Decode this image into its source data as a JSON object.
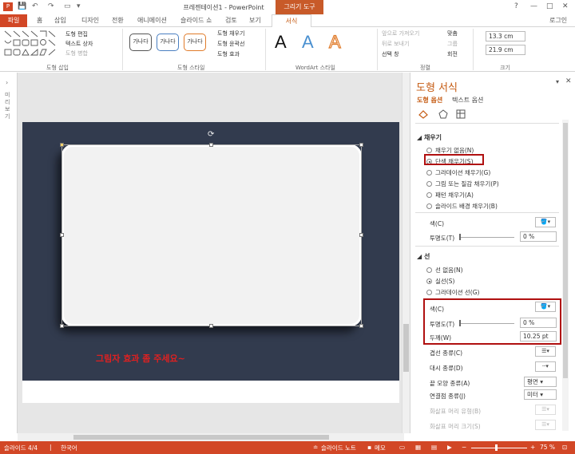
{
  "titlebar": {
    "app_title": "프레젠테이션1 - PowerPoint",
    "context_group": "그리기 도구",
    "help": "?",
    "minimize": "—",
    "restore": "□",
    "close": "✕"
  },
  "tabs": [
    "파일",
    "홈",
    "삽입",
    "디자인",
    "전환",
    "애니메이션",
    "슬라이드 쇼",
    "검토",
    "보기",
    "서식"
  ],
  "signin": "로그인",
  "ribbon": {
    "insert_shapes": {
      "label": "도형 삽입",
      "edit_shape": "도형 편집",
      "text_box": "텍스트 상자",
      "merge_shapes": "도형 병합"
    },
    "shape_styles": {
      "label": "도형 스타일",
      "thumb_text": "가나다",
      "fill": "도형 채우기",
      "outline": "도형 윤곽선",
      "effects": "도형 효과"
    },
    "wordart": {
      "label": "WordArt 스타일",
      "glyph": "A"
    },
    "arrange": {
      "label": "정렬",
      "bring_forward": "앞으로 가져오기",
      "send_backward": "뒤로 보내기",
      "selection_pane": "선택 창",
      "align": "맞춤",
      "group": "그룹",
      "rotate": "회전"
    },
    "size": {
      "label": "크기",
      "height": "13.3 cm",
      "width": "21.9 cm"
    }
  },
  "left_strip": {
    "label": "미리 보기"
  },
  "slide": {
    "caption": "그림자 효과 좀 주세요~"
  },
  "pane": {
    "title": "도형 서식",
    "tab_shape": "도형 옵션",
    "tab_text": "텍스트 옵션",
    "fill": {
      "heading": "채우기",
      "options": [
        "채우기 없음(N)",
        "단색 채우기(S)",
        "그라데이션 채우기(G)",
        "그림 또는 질감 채우기(P)",
        "패턴 채우기(A)",
        "슬라이드 배경 채우기(B)"
      ],
      "selected": 1,
      "color_label": "색(C)",
      "transparency_label": "투명도(T)",
      "transparency_value": "0 %"
    },
    "line": {
      "heading": "선",
      "options": [
        "선 없음(N)",
        "실선(S)",
        "그라데이션 선(G)"
      ],
      "selected": 1,
      "color_label": "색(C)",
      "transparency_label": "투명도(T)",
      "transparency_value": "0 %",
      "width_label": "두께(W)",
      "width_value": "10.25 pt",
      "compound_label": "겹선 종류(C)",
      "dash_label": "대시 종류(D)",
      "cap_label": "끝 모양 종류(A)",
      "cap_value": "평면",
      "join_label": "연결점 종류(J)",
      "join_value": "미터",
      "begin_arrow_label": "화살표 머리 유형(B)",
      "begin_size_label": "화살표 머리 크기(S)"
    }
  },
  "status": {
    "slide": "슬라이드 4/4",
    "language": "한국어",
    "notes": "슬라이드 노트",
    "comments": "메모",
    "zoom": "75 %"
  },
  "colors": {
    "accent": "#d24726",
    "format_tab": "#c55a11",
    "slide_bg": "#323b4e",
    "highlight": "#b01010",
    "caption": "#e02020"
  }
}
